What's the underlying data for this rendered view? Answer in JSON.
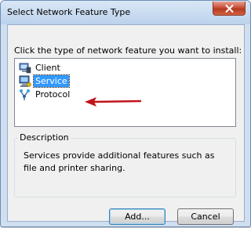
{
  "window": {
    "title": "Select Network Feature Type"
  },
  "prompt": "Click the type of network feature you want to install:",
  "features": [
    {
      "label": "Client",
      "icon": "client-icon",
      "selected": false
    },
    {
      "label": "Service",
      "icon": "service-icon",
      "selected": true
    },
    {
      "label": "Protocol",
      "icon": "protocol-icon",
      "selected": false
    }
  ],
  "description": {
    "title": "Description",
    "text": "Services provide additional features such as file and printer sharing."
  },
  "buttons": {
    "add": "Add...",
    "cancel": "Cancel"
  },
  "colors": {
    "selection": "#3399ff",
    "arrow": "#c0141b",
    "close": "#c8513a"
  }
}
